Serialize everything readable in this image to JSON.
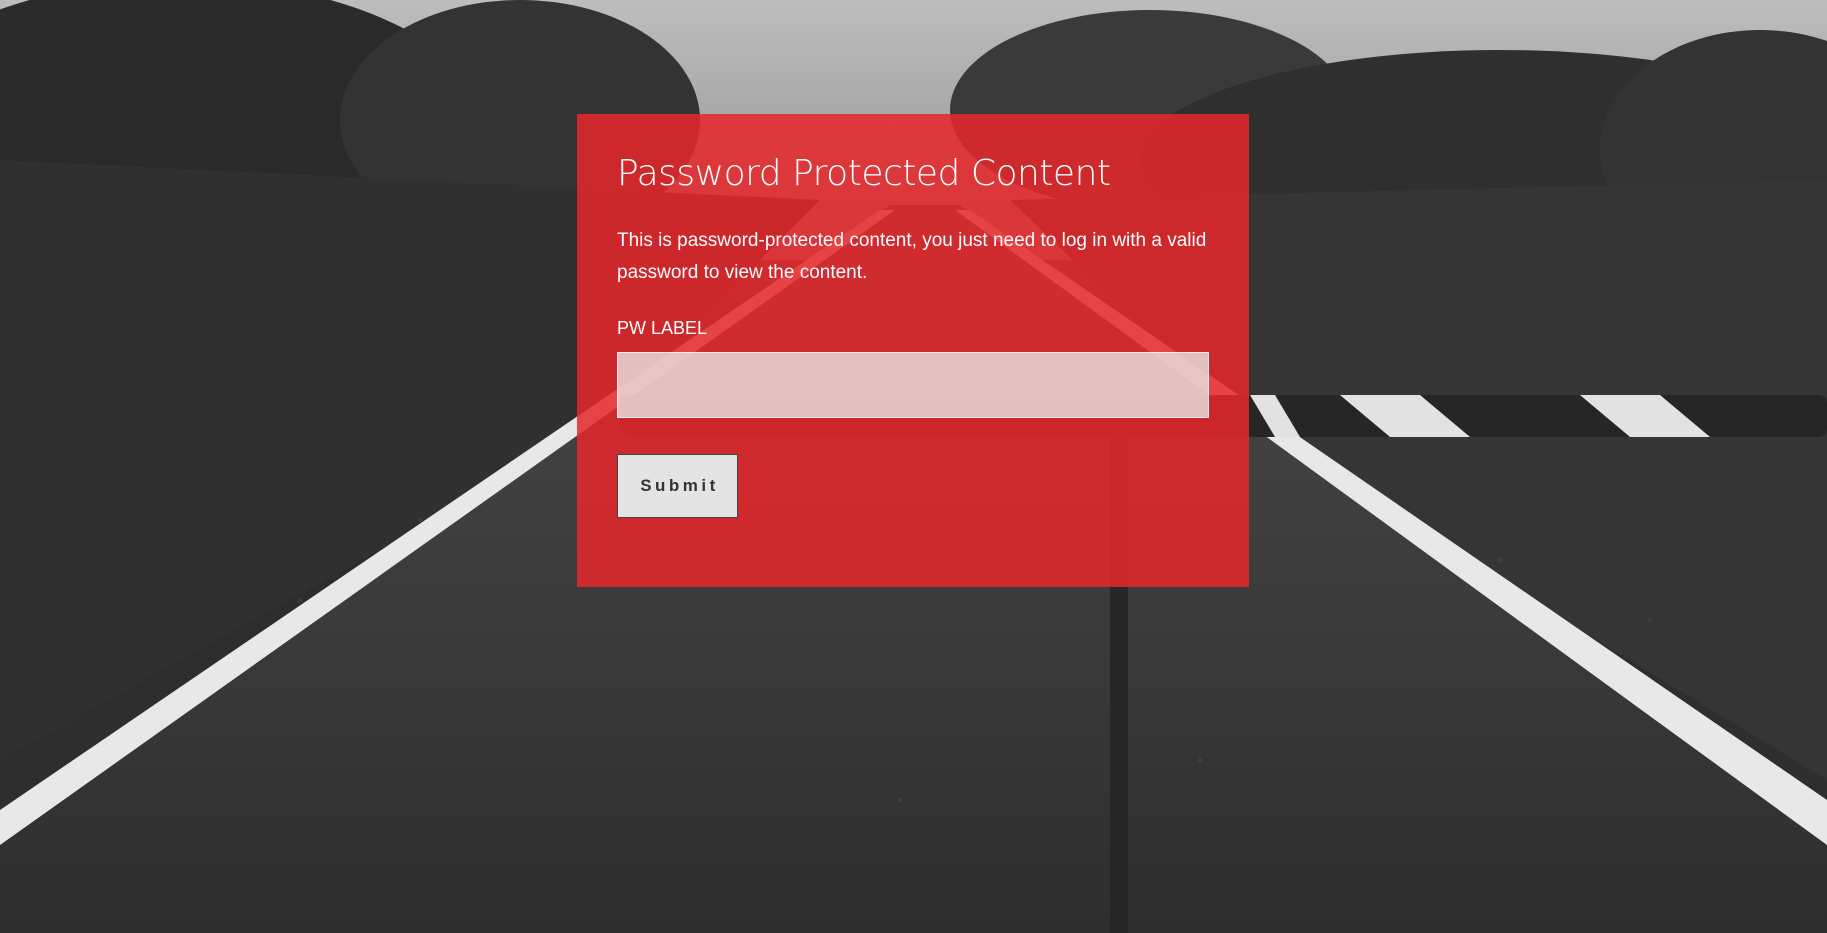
{
  "panel": {
    "title": "Password Protected Content",
    "description": "This is password-protected content, you just need to log in with a valid password to view the content.",
    "field_label": "PW LABEL",
    "field_value": "",
    "submit_label": "Submit"
  },
  "colors": {
    "panel_background": "#e6262a",
    "panel_text": "#ffffff",
    "button_background": "#e4e4e4",
    "button_text": "#333333"
  }
}
